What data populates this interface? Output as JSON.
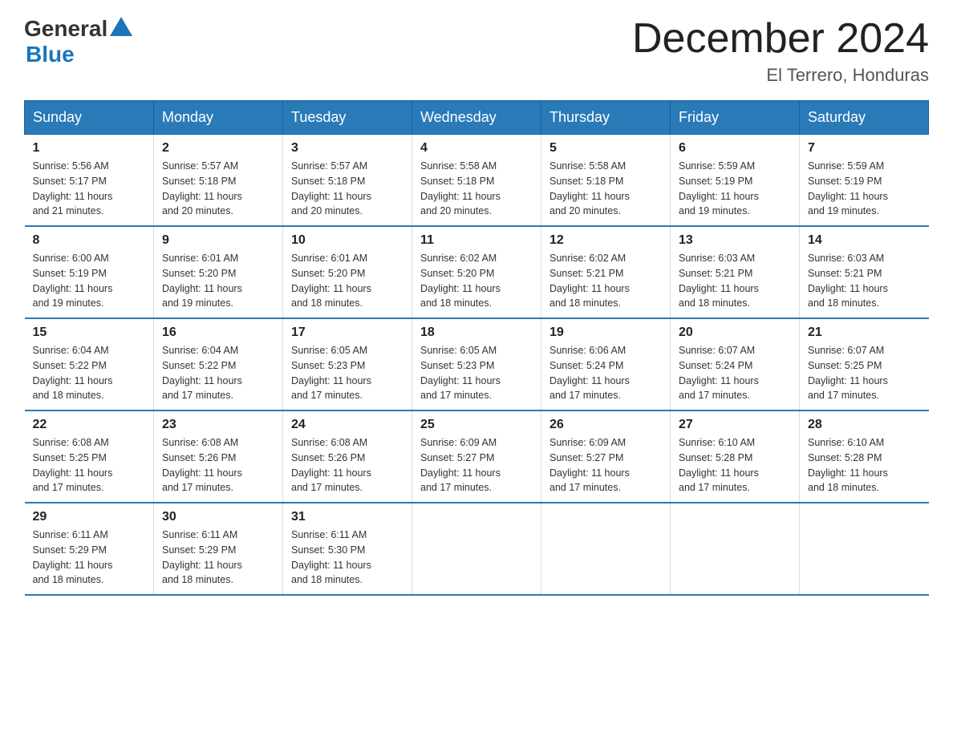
{
  "header": {
    "logo_general": "General",
    "logo_blue": "Blue",
    "month_title": "December 2024",
    "location": "El Terrero, Honduras"
  },
  "days_of_week": [
    "Sunday",
    "Monday",
    "Tuesday",
    "Wednesday",
    "Thursday",
    "Friday",
    "Saturday"
  ],
  "weeks": [
    [
      {
        "day": "1",
        "sunrise": "5:56 AM",
        "sunset": "5:17 PM",
        "daylight": "11 hours and 21 minutes."
      },
      {
        "day": "2",
        "sunrise": "5:57 AM",
        "sunset": "5:18 PM",
        "daylight": "11 hours and 20 minutes."
      },
      {
        "day": "3",
        "sunrise": "5:57 AM",
        "sunset": "5:18 PM",
        "daylight": "11 hours and 20 minutes."
      },
      {
        "day": "4",
        "sunrise": "5:58 AM",
        "sunset": "5:18 PM",
        "daylight": "11 hours and 20 minutes."
      },
      {
        "day": "5",
        "sunrise": "5:58 AM",
        "sunset": "5:18 PM",
        "daylight": "11 hours and 20 minutes."
      },
      {
        "day": "6",
        "sunrise": "5:59 AM",
        "sunset": "5:19 PM",
        "daylight": "11 hours and 19 minutes."
      },
      {
        "day": "7",
        "sunrise": "5:59 AM",
        "sunset": "5:19 PM",
        "daylight": "11 hours and 19 minutes."
      }
    ],
    [
      {
        "day": "8",
        "sunrise": "6:00 AM",
        "sunset": "5:19 PM",
        "daylight": "11 hours and 19 minutes."
      },
      {
        "day": "9",
        "sunrise": "6:01 AM",
        "sunset": "5:20 PM",
        "daylight": "11 hours and 19 minutes."
      },
      {
        "day": "10",
        "sunrise": "6:01 AM",
        "sunset": "5:20 PM",
        "daylight": "11 hours and 18 minutes."
      },
      {
        "day": "11",
        "sunrise": "6:02 AM",
        "sunset": "5:20 PM",
        "daylight": "11 hours and 18 minutes."
      },
      {
        "day": "12",
        "sunrise": "6:02 AM",
        "sunset": "5:21 PM",
        "daylight": "11 hours and 18 minutes."
      },
      {
        "day": "13",
        "sunrise": "6:03 AM",
        "sunset": "5:21 PM",
        "daylight": "11 hours and 18 minutes."
      },
      {
        "day": "14",
        "sunrise": "6:03 AM",
        "sunset": "5:21 PM",
        "daylight": "11 hours and 18 minutes."
      }
    ],
    [
      {
        "day": "15",
        "sunrise": "6:04 AM",
        "sunset": "5:22 PM",
        "daylight": "11 hours and 18 minutes."
      },
      {
        "day": "16",
        "sunrise": "6:04 AM",
        "sunset": "5:22 PM",
        "daylight": "11 hours and 17 minutes."
      },
      {
        "day": "17",
        "sunrise": "6:05 AM",
        "sunset": "5:23 PM",
        "daylight": "11 hours and 17 minutes."
      },
      {
        "day": "18",
        "sunrise": "6:05 AM",
        "sunset": "5:23 PM",
        "daylight": "11 hours and 17 minutes."
      },
      {
        "day": "19",
        "sunrise": "6:06 AM",
        "sunset": "5:24 PM",
        "daylight": "11 hours and 17 minutes."
      },
      {
        "day": "20",
        "sunrise": "6:07 AM",
        "sunset": "5:24 PM",
        "daylight": "11 hours and 17 minutes."
      },
      {
        "day": "21",
        "sunrise": "6:07 AM",
        "sunset": "5:25 PM",
        "daylight": "11 hours and 17 minutes."
      }
    ],
    [
      {
        "day": "22",
        "sunrise": "6:08 AM",
        "sunset": "5:25 PM",
        "daylight": "11 hours and 17 minutes."
      },
      {
        "day": "23",
        "sunrise": "6:08 AM",
        "sunset": "5:26 PM",
        "daylight": "11 hours and 17 minutes."
      },
      {
        "day": "24",
        "sunrise": "6:08 AM",
        "sunset": "5:26 PM",
        "daylight": "11 hours and 17 minutes."
      },
      {
        "day": "25",
        "sunrise": "6:09 AM",
        "sunset": "5:27 PM",
        "daylight": "11 hours and 17 minutes."
      },
      {
        "day": "26",
        "sunrise": "6:09 AM",
        "sunset": "5:27 PM",
        "daylight": "11 hours and 17 minutes."
      },
      {
        "day": "27",
        "sunrise": "6:10 AM",
        "sunset": "5:28 PM",
        "daylight": "11 hours and 17 minutes."
      },
      {
        "day": "28",
        "sunrise": "6:10 AM",
        "sunset": "5:28 PM",
        "daylight": "11 hours and 18 minutes."
      }
    ],
    [
      {
        "day": "29",
        "sunrise": "6:11 AM",
        "sunset": "5:29 PM",
        "daylight": "11 hours and 18 minutes."
      },
      {
        "day": "30",
        "sunrise": "6:11 AM",
        "sunset": "5:29 PM",
        "daylight": "11 hours and 18 minutes."
      },
      {
        "day": "31",
        "sunrise": "6:11 AM",
        "sunset": "5:30 PM",
        "daylight": "11 hours and 18 minutes."
      },
      null,
      null,
      null,
      null
    ]
  ],
  "labels": {
    "sunrise": "Sunrise:",
    "sunset": "Sunset:",
    "daylight": "Daylight:"
  }
}
